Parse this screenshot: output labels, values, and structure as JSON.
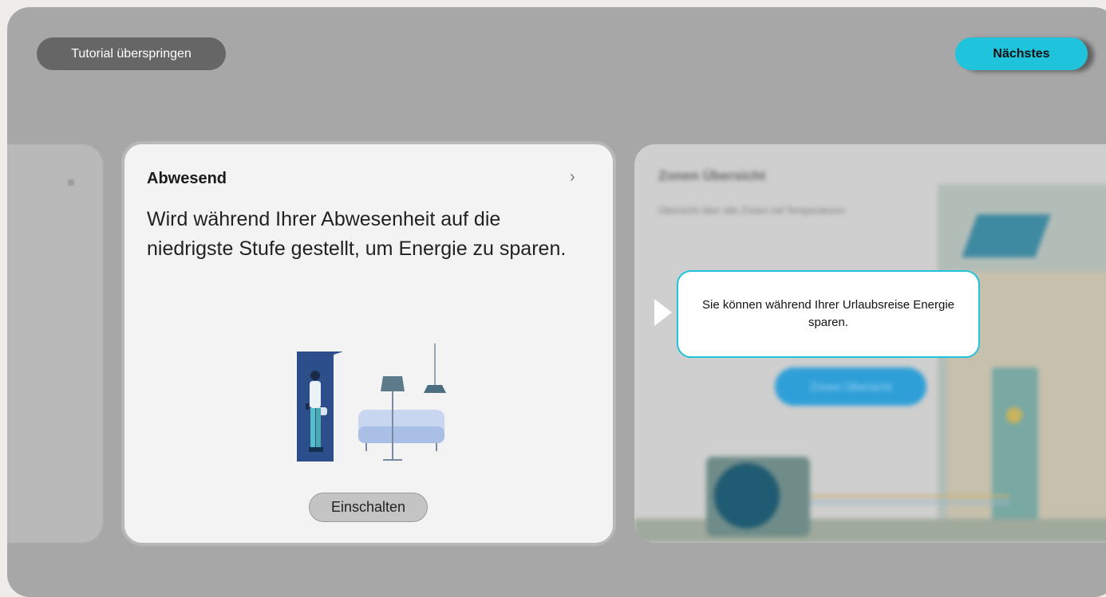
{
  "buttons": {
    "skip_label": "Tutorial überspringen",
    "next_label": "Nächstes"
  },
  "main_card": {
    "title": "Abwesend",
    "chevron": "›",
    "description": "Wird während Ihrer Abwesenheit auf die niedrigste Stufe gestellt, um Energie zu sparen.",
    "action_label": "Einschalten"
  },
  "right_card": {
    "title": "Zonen Übersicht",
    "subtitle": "Übersicht über alle Zonen mit Temperaturen",
    "button_label": "Zonen Übersicht"
  },
  "tooltip": {
    "text": "Sie können während Ihrer Urlaubsreise Energie sparen."
  },
  "colors": {
    "accent": "#1fc3dc",
    "overlay": "#a7a7a7",
    "card": "#f3f3f3",
    "illustration_dark_blue": "#2c4f8c",
    "illustration_light_blue": "#c9d6ef"
  },
  "icons": [
    "chevron-right-icon",
    "away-illustration",
    "tooltip-pointer-icon",
    "house-illustration"
  ]
}
